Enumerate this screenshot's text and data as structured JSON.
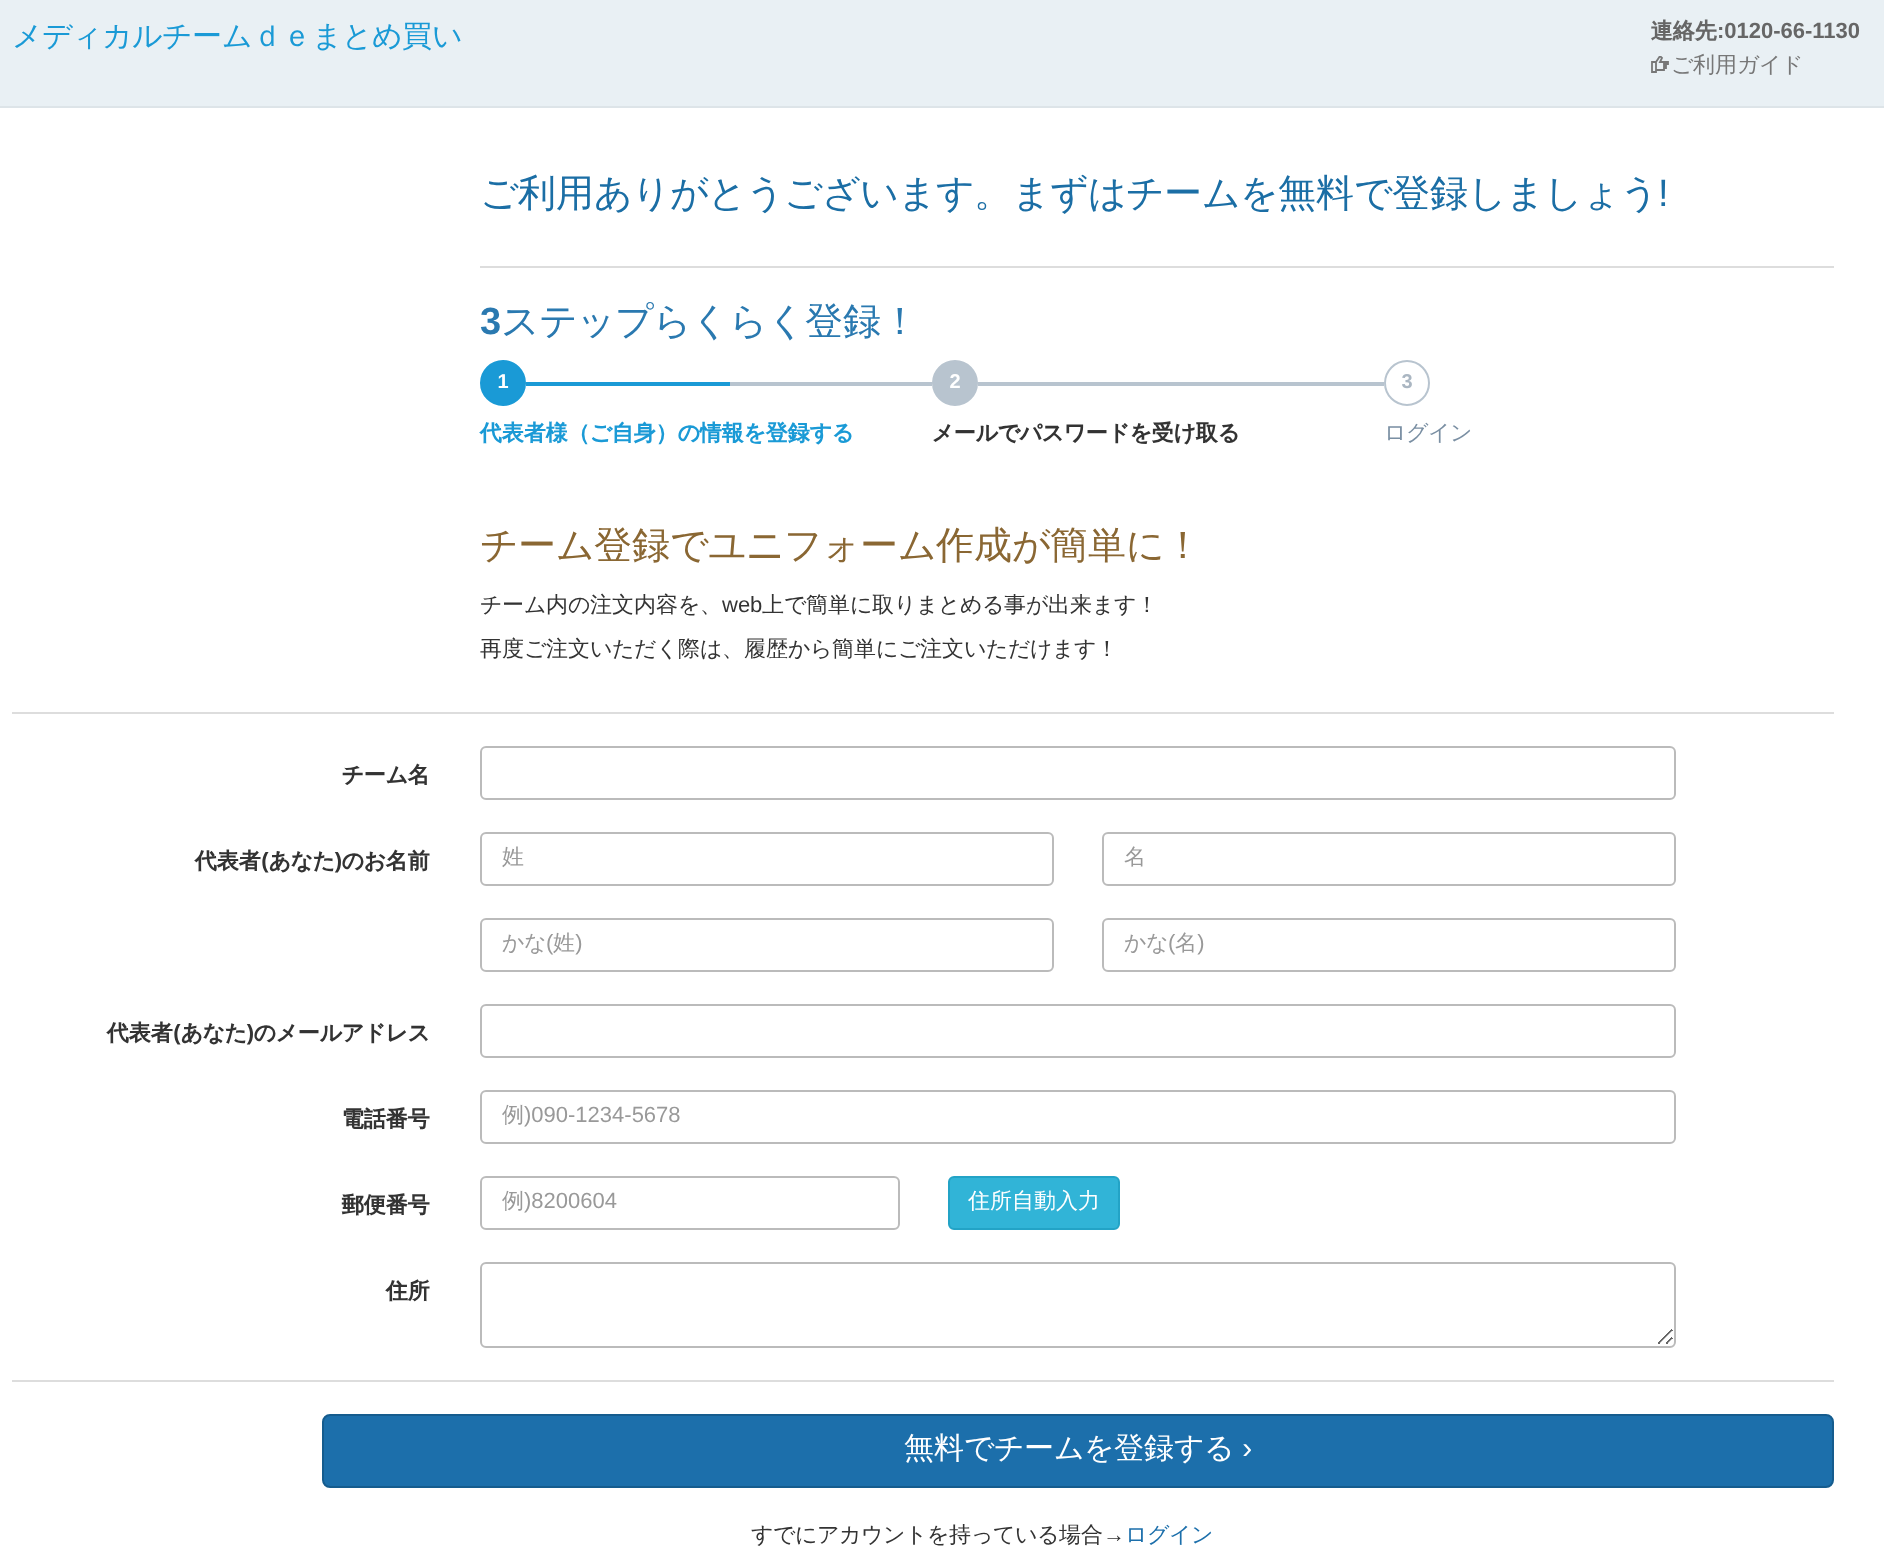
{
  "header": {
    "site_title": "メディカルチームｄｅまとめ買い",
    "contact": "連絡先:0120-66-1130",
    "guide_link": "ご利用ガイド"
  },
  "welcome": "ご利用ありがとうございます。まずはチームを無料で登録しましょう!",
  "steps_title": "**3**ステップらくらく登録！",
  "steps": [
    {
      "number": "1",
      "label": "代表者様（ご自身）の情報を登録する",
      "selected": true,
      "reached": true,
      "level": 0.5
    },
    {
      "number": "2",
      "label": "メールでパスワードを受け取る",
      "selected": false,
      "reached": true
    },
    {
      "number": "3",
      "label": "ログイン",
      "selected": false,
      "reached": false
    }
  ],
  "promo": {
    "heading": "チーム登録でユニフォーム作成が簡単に！",
    "lines": [
      "チーム内の注文内容を、web上で簡単に取りまとめる事が出来ます！",
      "再度ご注文いただく際は、履歴から簡単にご注文いただけます！"
    ]
  },
  "form_rows": [
    {
      "label": "チーム名",
      "fields": [
        {
          "kind": "input"
        }
      ]
    },
    {
      "label": "代表者(あなた)のお名前",
      "fields": [
        {
          "kind": "input",
          "placeholder": "姓"
        },
        {
          "kind": "input",
          "placeholder": "名"
        }
      ]
    },
    {
      "fields": [
        {
          "kind": "input",
          "placeholder": "かな(姓)"
        },
        {
          "kind": "input",
          "placeholder": "かな(名)"
        }
      ]
    },
    {
      "label": "代表者(あなた)のメールアドレス",
      "fields": [
        {
          "kind": "input"
        }
      ]
    },
    {
      "label": "電話番号",
      "fields": [
        {
          "kind": "input",
          "placeholder": "例)090-1234-5678"
        }
      ]
    },
    {
      "label": "郵便番号",
      "fields": [
        {
          "kind": "input",
          "placeholder": "例)8200604"
        },
        {
          "kind": "button",
          "label": "住所自動入力"
        }
      ]
    },
    {
      "label": "住所",
      "fields": [
        {
          "kind": "textarea"
        }
      ]
    }
  ],
  "submit": "無料でチームを登録する ›",
  "footer": {
    "text": "すでにアカウントを持っている場合→",
    "link": "ログイン"
  }
}
